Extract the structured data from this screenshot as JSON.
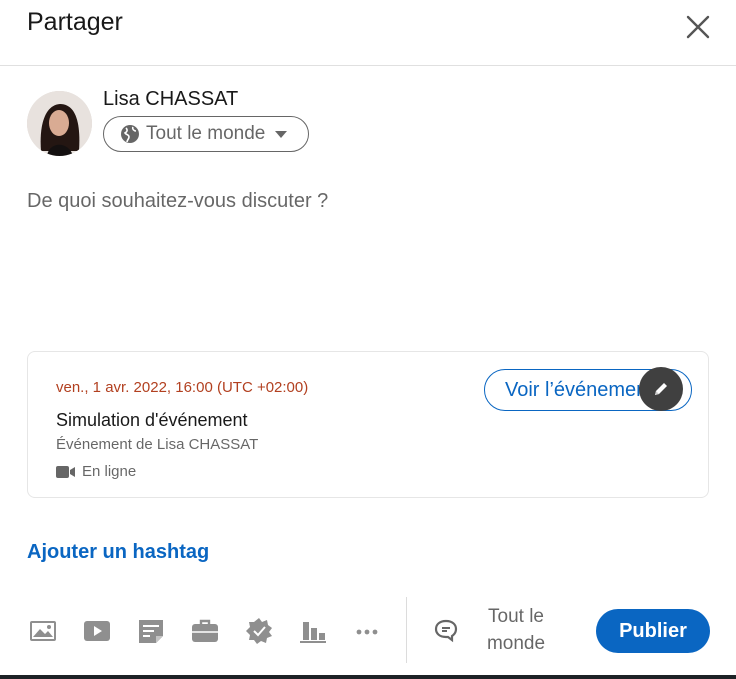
{
  "header": {
    "title": "Partager"
  },
  "author": {
    "name": "Lisa CHASSAT",
    "audience": "Tout le monde"
  },
  "editor": {
    "placeholder": "De quoi souhaitez-vous discuter ?"
  },
  "event": {
    "date": "ven., 1 avr. 2022, 16:00 (UTC +02:00)",
    "title": "Simulation d'événement",
    "organizer": "Événement de Lisa CHASSAT",
    "mode": "En ligne",
    "view_label": "Voir l’événement"
  },
  "hashtag_label": "Ajouter un hashtag",
  "footer": {
    "tools": [
      "photo-icon",
      "video-icon",
      "document-icon",
      "job-icon",
      "celebrate-icon",
      "poll-icon",
      "more-icon"
    ],
    "comment_setting": "Tout le monde",
    "publish_label": "Publier"
  },
  "colors": {
    "primary": "#0a66c2",
    "event_date": "#b24020",
    "muted": "#666666"
  }
}
